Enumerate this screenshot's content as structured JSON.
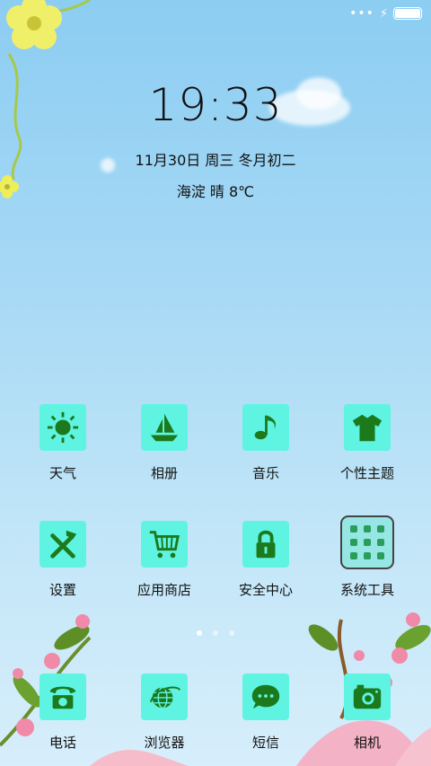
{
  "status_bar": {
    "signal_icon": "dots-icon",
    "charging_icon": "bolt-icon",
    "battery_icon": "battery-icon"
  },
  "clock": {
    "time": "19:33"
  },
  "date": {
    "text": "11月30日  周三  冬月初二"
  },
  "weather": {
    "text": "海淀  晴  8℃"
  },
  "apps_row1": [
    {
      "label": "天气",
      "icon": "sun-icon"
    },
    {
      "label": "相册",
      "icon": "sailboat-icon"
    },
    {
      "label": "音乐",
      "icon": "music-note-icon"
    },
    {
      "label": "个性主题",
      "icon": "tshirt-icon"
    }
  ],
  "apps_row2": [
    {
      "label": "设置",
      "icon": "tools-icon"
    },
    {
      "label": "应用商店",
      "icon": "shopping-cart-icon"
    },
    {
      "label": "安全中心",
      "icon": "lock-icon"
    },
    {
      "label": "系统工具",
      "icon": "folder-icon"
    }
  ],
  "dock": [
    {
      "label": "电话",
      "icon": "phone-icon"
    },
    {
      "label": "浏览器",
      "icon": "globe-icon"
    },
    {
      "label": "短信",
      "icon": "message-icon"
    },
    {
      "label": "相机",
      "icon": "camera-icon"
    }
  ],
  "pager": {
    "pages": 3,
    "active_index": 0
  },
  "colors": {
    "tile": "#5ff4e2",
    "icon_glyph": "#1c7a1c"
  }
}
